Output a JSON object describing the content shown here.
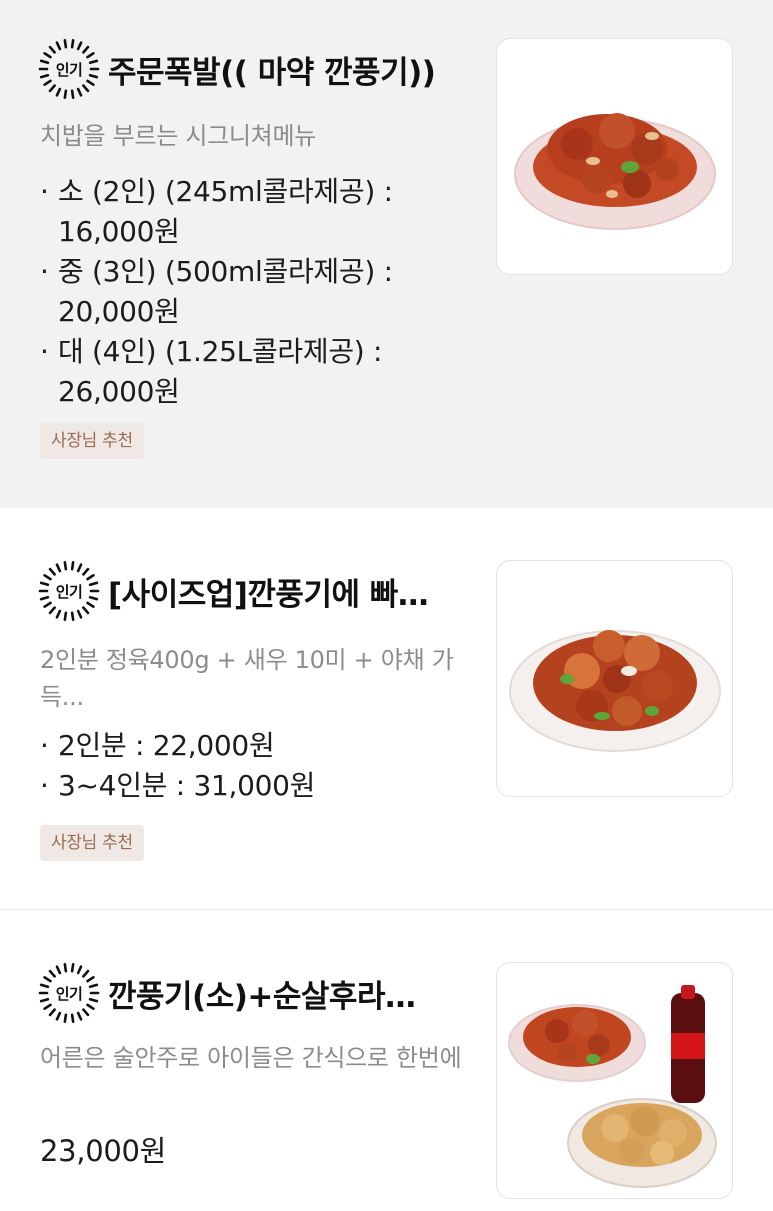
{
  "menu": [
    {
      "badge": "인기",
      "title": "주문폭발(( 마약 깐풍기))",
      "description": "치밥을 부르는 시그니쳐메뉴",
      "options": [
        {
          "label": "소 (2인) (245ml콜라제공) : 16,000원"
        },
        {
          "label": "중 (3인) (500ml콜라제공) : 20,000원"
        },
        {
          "label": "대 (4인) (1.25L콜라제공) : 26,000원"
        }
      ],
      "tag": "사장님 추천",
      "image_icon": "kkanpunggi-plate-image"
    },
    {
      "badge": "인기",
      "title": "[사이즈업]깐풍기에 빠…",
      "description": "2인분 정육400g + 새우 10미 + 야채 가득...",
      "options": [
        {
          "label": "2인분 : 22,000원"
        },
        {
          "label": "3~4인분 : 31,000원"
        }
      ],
      "tag": "사장님 추천",
      "image_icon": "shrimp-kkanpunggi-plate-image"
    },
    {
      "badge": "인기",
      "title": "깐풍기(소)+순살후라…",
      "description": "어른은 술안주로 아이들은 간식으로 한번에",
      "price": "23,000원",
      "image_icon": "kkanpunggi-fried-chicken-cola-set-image"
    }
  ],
  "colors": {
    "popular_section_bg": "#f2f2f2",
    "tag_bg": "#efe8e4",
    "tag_text": "#9a6b50",
    "description_text": "#8c8c8c"
  }
}
